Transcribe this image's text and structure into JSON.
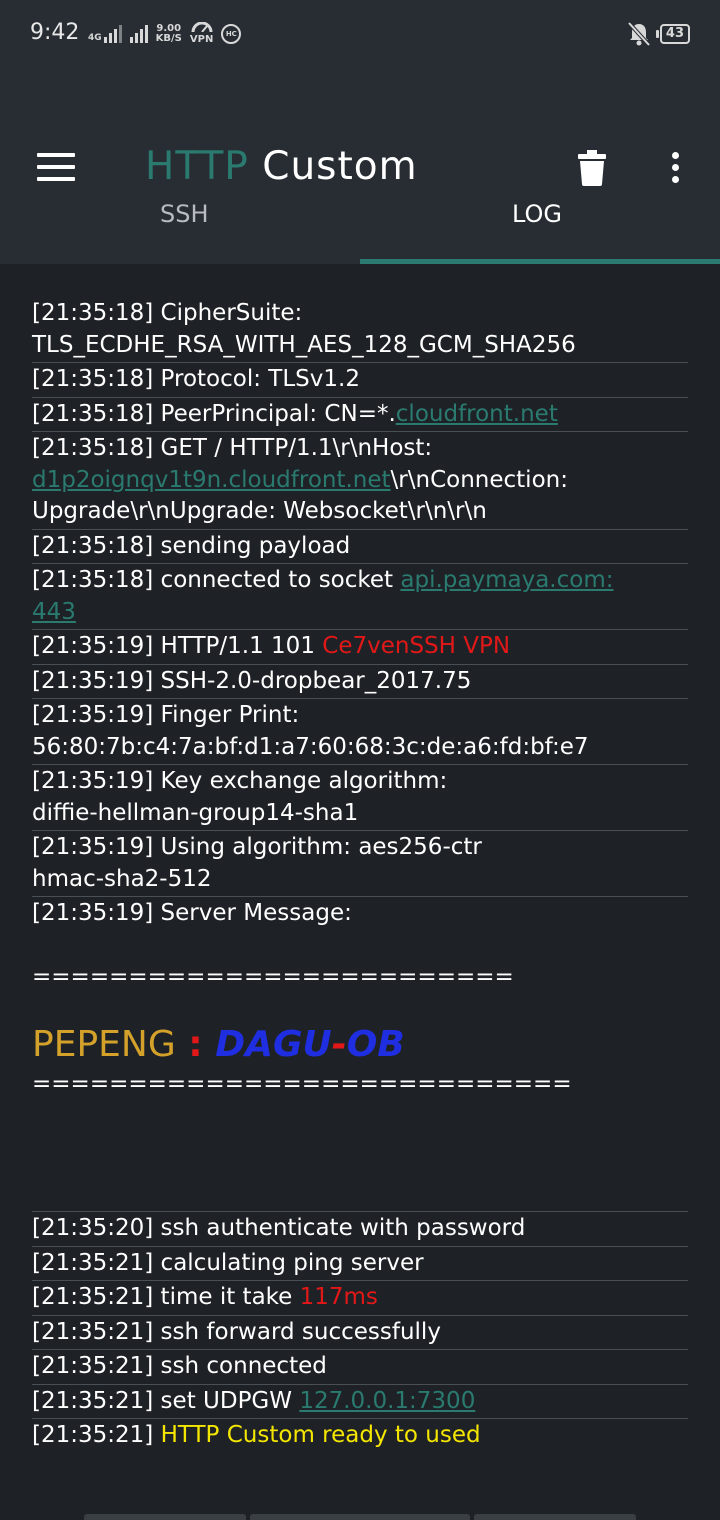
{
  "status_bar": {
    "time": "9:42",
    "network_type": "4G",
    "speed_value": "9.00",
    "speed_unit": "KB/S",
    "vpn_label": "VPN",
    "hc_label": "HC",
    "battery": "43"
  },
  "app_bar": {
    "title_part1": "HTTP",
    "title_part2": "Custom"
  },
  "tabs": [
    {
      "label": "SSH",
      "active": false
    },
    {
      "label": "LOG",
      "active": true
    }
  ],
  "colors": {
    "accent": "#2a7a70",
    "background": "#1e2226",
    "appbar": "#272d33",
    "red": "#e21818",
    "yellow": "#f5e600"
  },
  "log": {
    "e1_a": "[21:35:18] CipherSuite:",
    "e1_b": "TLS_ECDHE_RSA_WITH_AES_128_GCM_SHA256",
    "e2": "[21:35:18] Protocol: TLSv1.2",
    "e3_a": "[21:35:18] PeerPrincipal: CN=*.",
    "e3_link": "cloudfront.net",
    "e4_a": "[21:35:18] GET / HTTP/1.1\\r\\nHost:",
    "e4_link": "d1p2oignqv1t9n.cloudfront.net",
    "e4_b": "\\r\\nConnection:",
    "e4_c": "Upgrade\\r\\nUpgrade: Websocket\\r\\n\\r\\n",
    "e5": "[21:35:18] sending payload",
    "e6_a": "[21:35:18] connected to socket ",
    "e6_link1": "api.paymaya.com:",
    "e6_link2": "443",
    "e7_a": "[21:35:19] HTTP/1.1 101 ",
    "e7_red": "Ce7venSSH VPN",
    "e8": "[21:35:19] SSH-2.0-dropbear_2017.75",
    "e9_a": "[21:35:19] Finger Print:",
    "e9_b": "56:80:7b:c4:7a:bf:d1:a7:60:68:3c:de:a6:fd:bf:e7",
    "e10_a": "[21:35:19] Key exchange algorithm:",
    "e10_b": "diffie-hellman-group14-sha1",
    "e11_a": "[21:35:19] Using algorithm: aes256-ctr",
    "e11_b": "hmac-sha2-512",
    "e12": "[21:35:19] Server Message:",
    "sep1": "=========================",
    "pepeng_name": "PEPENG",
    "pepeng_colon": " : ",
    "pepeng_dagu": "DAGU",
    "pepeng_dash": "-",
    "pepeng_ob": "OB",
    "sep2": "============================",
    "e13": "[21:35:20] ssh authenticate with password",
    "e14": "[21:35:21] calculating ping server",
    "e15_a": "[21:35:21] time it take ",
    "e15_red": "117ms",
    "e16": "[21:35:21] ssh forward successfully",
    "e17": "[21:35:21] ssh connected",
    "e18_a": "[21:35:21] set UDPGW ",
    "e18_link": "127.0.0.1:7300",
    "e19_a": "[21:35:21] ",
    "e19_yellow": "HTTP Custom ready to used"
  }
}
